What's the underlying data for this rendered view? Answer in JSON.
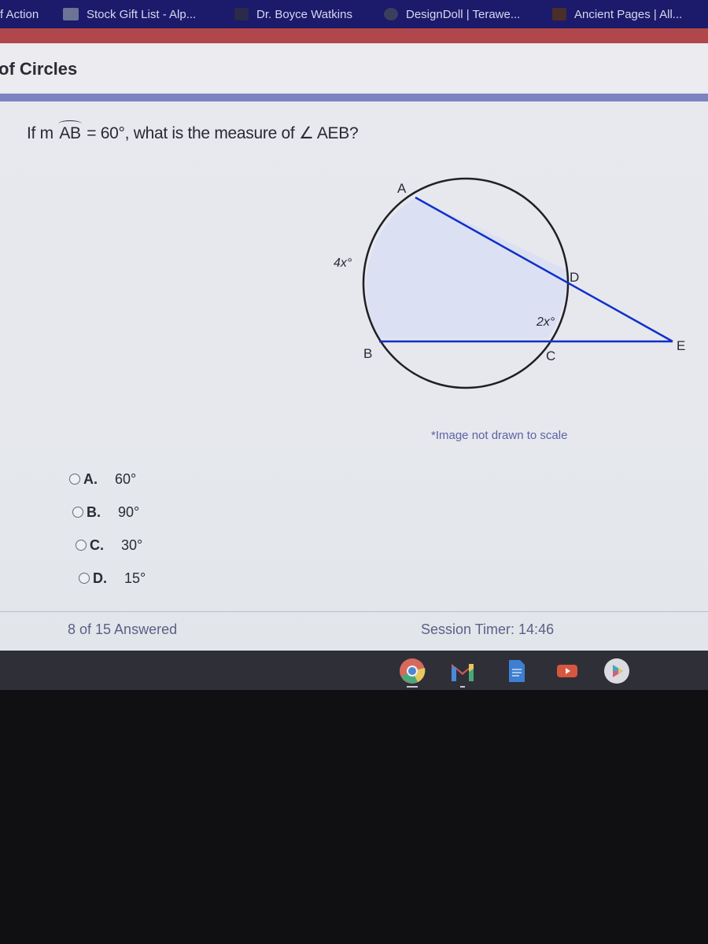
{
  "bookmarks": [
    {
      "label": "f Action",
      "icon": "bookmark-icon"
    },
    {
      "label": "Stock Gift List - Alp...",
      "icon": "stock-site-icon"
    },
    {
      "label": "Dr. Boyce Watkins",
      "icon": "site-icon"
    },
    {
      "label": "DesignDoll | Terawe...",
      "icon": "designdoll-icon"
    },
    {
      "label": "Ancient Pages | All...",
      "icon": "ancient-pages-icon"
    }
  ],
  "page": {
    "title": "of Circles",
    "question": {
      "prefix": "If m",
      "arc": "AB",
      "middle": " = 60°, what is the measure of ",
      "angle_symbol": "∠",
      "suffix": " AEB?"
    },
    "figure": {
      "points": {
        "A": "A",
        "B": "B",
        "C": "C",
        "D": "D",
        "E": "E"
      },
      "arc_label_major": "4x°",
      "arc_label_minor": "2x°",
      "colors": {
        "circle": "#1f1f24",
        "secant": "#1030c8",
        "fill": "#dbe1f3"
      }
    },
    "note": "*Image not drawn to scale",
    "choices": [
      {
        "letter": "A.",
        "value": "60°",
        "selected": false
      },
      {
        "letter": "B.",
        "value": "90°",
        "selected": false
      },
      {
        "letter": "C.",
        "value": "30°",
        "selected": false
      },
      {
        "letter": "D.",
        "value": "15°",
        "selected": false
      }
    ],
    "progress": "8 of 15 Answered",
    "timer": "Session Timer: 14:46"
  },
  "shelf": {
    "apps": [
      "chrome",
      "gmail",
      "docs",
      "youtube",
      "play-store"
    ]
  }
}
